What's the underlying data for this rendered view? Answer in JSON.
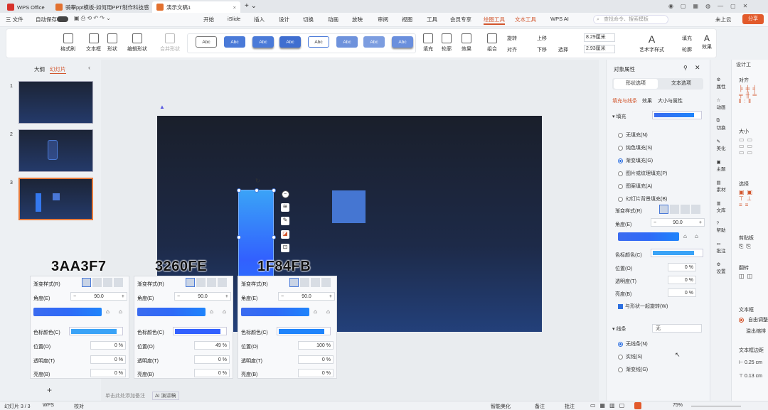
{
  "tabs": [
    {
      "label": "WPS Office"
    },
    {
      "label": "骑攀ppt模板-如何用PPT制作科技感"
    },
    {
      "label": "演示文稿1"
    }
  ],
  "menu": {
    "file": "三 文件",
    "autosave": "自动保存",
    "items": [
      "开始",
      "iSlide",
      "插入",
      "设计",
      "切换",
      "动画",
      "放映",
      "审阅",
      "视图",
      "工具",
      "会员专享",
      "绘图工具",
      "文本工具",
      "WPS AI"
    ],
    "search_placeholder": "查找命令、搜索模板",
    "cloud": "未上云",
    "share": "分享"
  },
  "ribbon": {
    "format_painter": "格式刷",
    "textbox": "文本框",
    "shape": "形状",
    "edit_shape": "编辑形状",
    "merge_shape": "合并形状",
    "swatch_text": "Abc",
    "fill": "填充",
    "outline": "轮廓",
    "effect": "效果",
    "group": "组合",
    "rotate": "旋转",
    "align": "对齐",
    "up": "上移",
    "down": "下移",
    "select": "选择",
    "height": "8.29厘米",
    "width": "2.93厘米",
    "art_style": "艺术字样式",
    "text_fill": "填充",
    "text_outline": "轮廓",
    "text_effect": "效果"
  },
  "left": {
    "outline_tab": "大纲",
    "slides_tab": "幻灯片",
    "slide_numbers": [
      "1",
      "2",
      "3"
    ],
    "add": "+"
  },
  "prop": {
    "title": "对象属性",
    "tab_shape": "形状选项",
    "tab_text": "文本选项",
    "sub_fill_line": "填充与线条",
    "sub_effect": "效果",
    "sub_size": "大小与属性",
    "fill_header": "填充",
    "fill_options": [
      "无填充(N)",
      "纯色填充(S)",
      "渐变填充(G)",
      "图片或纹理填充(P)",
      "图案填充(A)",
      "幻灯片背景填充(B)"
    ],
    "gradient_style": "渐变样式(R)",
    "angle_label": "角度(E)",
    "angle_value": "90.0",
    "stop_color": "色标颜色(C)",
    "position": "位置(O)",
    "position_value": "0",
    "transparency": "透明度(T)",
    "transparency_value": "0",
    "brightness": "亮度(B)",
    "brightness_value": "0",
    "rotate_with_shape": "与形状一起旋转(W)",
    "line_header": "线条",
    "line_value": "无",
    "line_options": [
      "无线条(N)",
      "实线(S)",
      "渐变线(G)"
    ],
    "pct": "%"
  },
  "sidebar": [
    "属性",
    "动画",
    "切换",
    "美化",
    "主题",
    "素材",
    "文库",
    "帮助",
    "批注",
    "设置"
  ],
  "design": {
    "title": "设计工",
    "align": "对齐",
    "size": "大小",
    "select": "选择",
    "clip": "剪贴板",
    "flip": "翻转",
    "textbox": "文本框",
    "autofit": "自由调整",
    "overflow": "溢出缩排",
    "margin": "文本框边距",
    "m1": "0.25 cm",
    "m2": "0.13 cm"
  },
  "panels": [
    {
      "hex": "3AA3F7",
      "position": "0",
      "transparency": "0",
      "brightness": "0",
      "color": "#3aa3f7"
    },
    {
      "hex": "3260FE",
      "position": "49",
      "transparency": "0",
      "brightness": "0",
      "color": "#3260fe"
    },
    {
      "hex": "1F84FB",
      "position": "100",
      "transparency": "0",
      "brightness": "0",
      "color": "#1f84fb"
    }
  ],
  "notes_placeholder": "单击此处添加备注",
  "ai_notes": "AI 演讲稿",
  "status": {
    "slide": "幻灯片 3 / 3",
    "wps": "WPS",
    "proof": "校对",
    "beautify": "智能美化",
    "notes": "备注",
    "comments": "批注",
    "zoom": "75%"
  }
}
